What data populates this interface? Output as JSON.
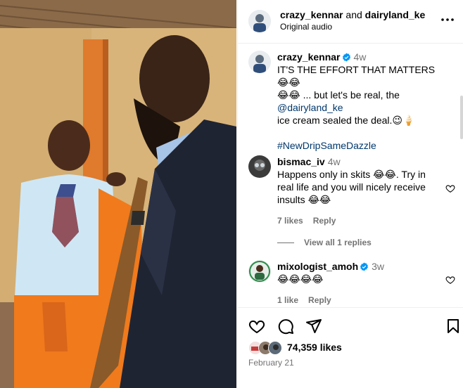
{
  "header": {
    "author": "crazy_kennar",
    "joiner": "and",
    "collaborator": "dairyland_ke",
    "audio": "Original audio",
    "more_icon": "more-horizontal-icon"
  },
  "caption": {
    "username": "crazy_kennar",
    "time": "4w",
    "line1": "IT'S THE EFFORT THAT MATTERS😂😂",
    "line2": "😂😂 ... but let's be real, the",
    "mention": "@dairyland_ke",
    "line3": "ice cream sealed the deal.😉🍦",
    "hashtag": "#NewDripSameDazzle"
  },
  "comments": [
    {
      "username": "bismac_iv",
      "time": "4w",
      "text_l1": "Happens only in skits 😂😂. Try in",
      "text_l2": "real life and you will nicely receive",
      "text_l3": "insults 😂😂",
      "likes": "7 likes",
      "reply": "Reply",
      "view_replies": "View all 1 replies"
    },
    {
      "username": "mixologist_amoh",
      "time": "3w",
      "text": "😂😂😂😂",
      "likes": "1 like",
      "reply": "Reply"
    }
  ],
  "actions": {
    "likes": "74,359 likes",
    "date": "February 21"
  },
  "colors": {
    "link": "#00376b",
    "verified": "#0095f6",
    "muted": "#737373",
    "coverall": "#f07a1c"
  }
}
